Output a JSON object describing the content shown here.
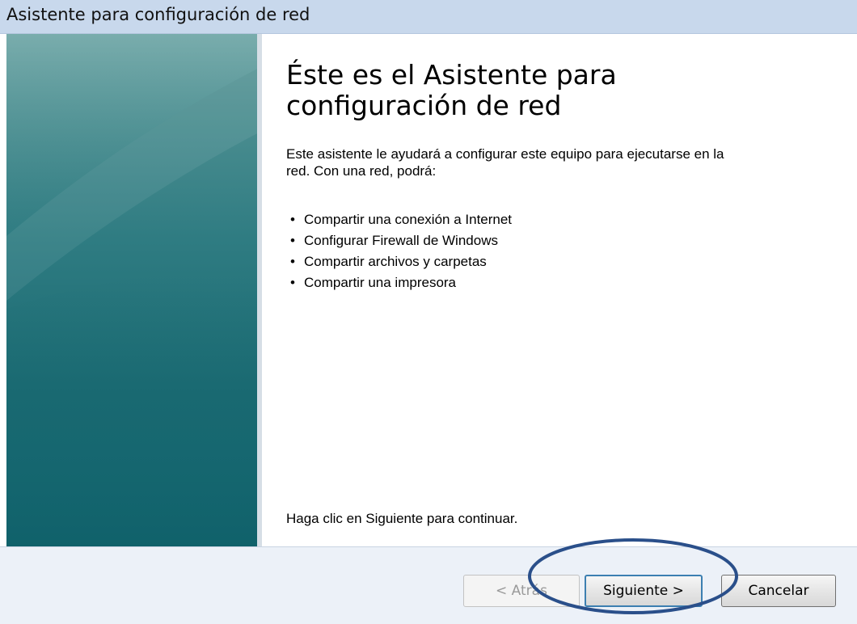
{
  "window": {
    "title": "Asistente para configuración de red"
  },
  "content": {
    "heading": "Éste es el Asistente para configuración de red",
    "intro": "Este asistente le ayudará a configurar este equipo para ejecutarse en la red. Con una red, podrá:",
    "bullets": [
      "Compartir una conexión a Internet",
      "Configurar Firewall de Windows",
      "Compartir archivos y carpetas",
      "Compartir una impresora"
    ],
    "footer": "Haga clic en Siguiente para continuar."
  },
  "buttons": {
    "back": "< Atrás",
    "next": "Siguiente >",
    "cancel": "Cancelar"
  },
  "colors": {
    "highlight": "#2a4f8a"
  }
}
